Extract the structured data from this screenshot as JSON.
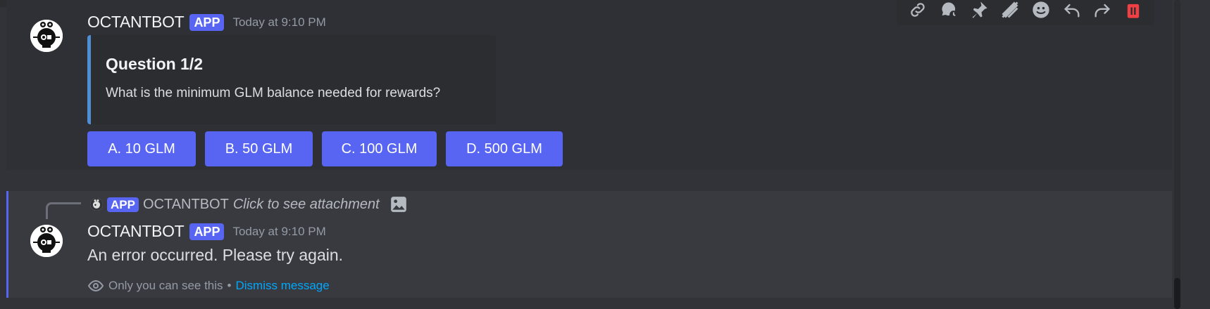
{
  "message1": {
    "username": "OCTANTBOT",
    "badge": "APP",
    "timestamp": "Today at 9:10 PM",
    "embed": {
      "title": "Question 1/2",
      "description": "What is the minimum GLM balance needed for rewards?",
      "accent_color": "#4e8fd6"
    },
    "buttons": [
      {
        "label": "A. 10 GLM"
      },
      {
        "label": "B. 50 GLM"
      },
      {
        "label": "C. 100 GLM"
      },
      {
        "label": "D. 500 GLM"
      }
    ]
  },
  "toolbar": {
    "icons": [
      "link-icon",
      "thread-icon",
      "pin-icon",
      "apps-icon",
      "emoji-icon",
      "reply-icon",
      "forward-icon",
      "delete-icon"
    ]
  },
  "message2": {
    "reply": {
      "badge": "APP",
      "username": "OCTANTBOT",
      "text": "Click to see attachment"
    },
    "username": "OCTANTBOT",
    "badge": "APP",
    "timestamp": "Today at 9:10 PM",
    "content": "An error occurred. Please try again.",
    "ephemeral_text": "Only you can see this",
    "separator": "•",
    "dismiss_label": "Dismiss message"
  },
  "colors": {
    "blurple": "#5865f2",
    "background": "#313338",
    "link": "#00a8fc",
    "danger": "#f23f43"
  }
}
